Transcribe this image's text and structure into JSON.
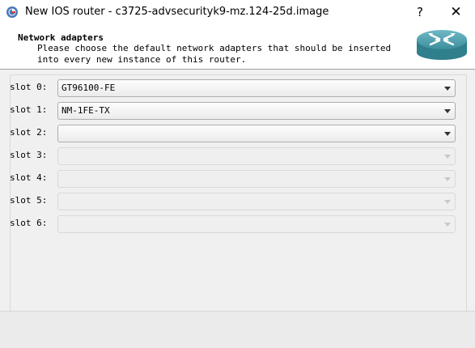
{
  "window": {
    "title": "New IOS router - c3725-advsecurityk9-mz.124-25d.image",
    "help_glyph": "?",
    "close_glyph": "✕"
  },
  "header": {
    "title": "Network adapters",
    "subtitle": "Please choose the default network adapters that should be inserted into every new instance of this router."
  },
  "slots": [
    {
      "label": "slot 0:",
      "value": "GT96100-FE",
      "enabled": true
    },
    {
      "label": "slot 1:",
      "value": "NM-1FE-TX",
      "enabled": true
    },
    {
      "label": "slot 2:",
      "value": "",
      "enabled": true
    },
    {
      "label": "slot 3:",
      "value": "",
      "enabled": false
    },
    {
      "label": "slot 4:",
      "value": "",
      "enabled": false
    },
    {
      "label": "slot 5:",
      "value": "",
      "enabled": false
    },
    {
      "label": "slot 6:",
      "value": "",
      "enabled": false
    }
  ],
  "icons": {
    "app": "gns3-app-icon",
    "router": "router-icon"
  }
}
